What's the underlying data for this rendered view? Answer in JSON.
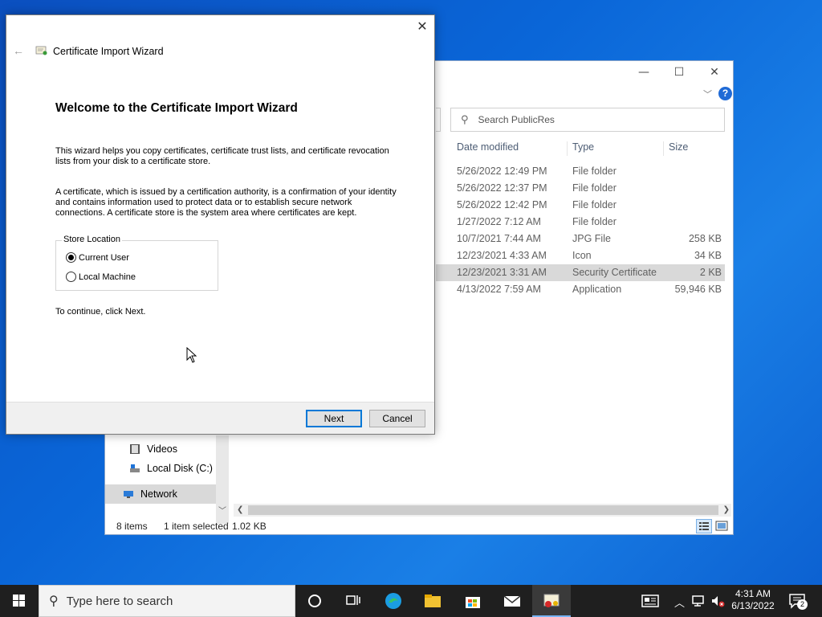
{
  "explorer": {
    "search_placeholder": "Search PublicRes",
    "columns": {
      "date": "Date modified",
      "type": "Type",
      "size": "Size"
    },
    "rows": [
      {
        "date": "5/26/2022 12:49 PM",
        "type": "File folder",
        "size": ""
      },
      {
        "date": "5/26/2022 12:37 PM",
        "type": "File folder",
        "size": ""
      },
      {
        "date": "5/26/2022 12:42 PM",
        "type": "File folder",
        "size": ""
      },
      {
        "date": "1/27/2022 7:12 AM",
        "type": "File folder",
        "size": ""
      },
      {
        "date": "10/7/2021 7:44 AM",
        "type": "JPG File",
        "size": "258 KB"
      },
      {
        "date": "12/23/2021 4:33 AM",
        "type": "Icon",
        "size": "34 KB"
      },
      {
        "date": "12/23/2021 3:31 AM",
        "type": "Security Certificate",
        "size": "2 KB"
      },
      {
        "date": "4/13/2022 7:59 AM",
        "type": "Application",
        "size": "59,946 KB"
      }
    ],
    "nav": {
      "videos": "Videos",
      "local_disk": "Local Disk (C:)",
      "network": "Network"
    },
    "status": {
      "items": "8 items",
      "selected": "1 item selected",
      "size": "1.02 KB"
    }
  },
  "wizard": {
    "title": "Certificate Import Wizard",
    "heading": "Welcome to the Certificate Import Wizard",
    "para1_line1": "This wizard helps you copy certificates, certificate trust lists, and certificate revocation",
    "para1_line2": "lists from your disk to a certificate store.",
    "para2_line1": "A certificate, which is issued by a certification authority, is a confirmation of your identity",
    "para2_line2": "and contains information used to protect data or to establish secure network",
    "para2_line3": "connections. A certificate store is the system area where certificates are kept.",
    "store_location_label": "Store Location",
    "option_current_user": "Current User",
    "option_local_machine": "Local Machine",
    "continue_text": "To continue, click Next.",
    "next_label": "Next",
    "cancel_label": "Cancel"
  },
  "taskbar": {
    "search_placeholder": "Type here to search",
    "time": "4:31 AM",
    "date": "6/13/2022",
    "notification_count": "2"
  }
}
